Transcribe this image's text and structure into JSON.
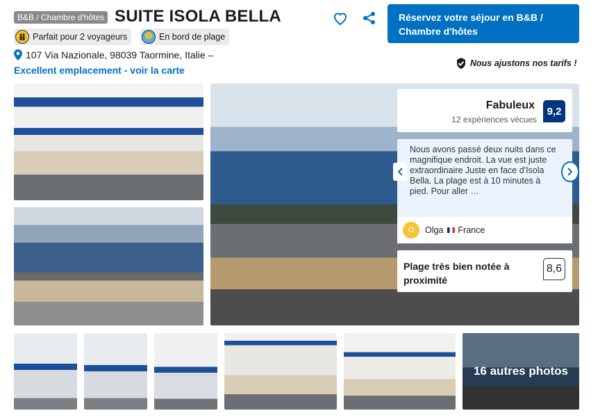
{
  "header": {
    "type_badge": "B&B / Chambre d'hôtes",
    "title": "SUITE ISOLA BELLA",
    "tags": [
      {
        "label": "Parfait pour 2 voyageurs",
        "icon": "people-icon"
      },
      {
        "label": "En bord de plage",
        "icon": "beach-icon"
      }
    ],
    "address": "107 Via Nazionale, 98039 Taormine, Italie –",
    "map_link": "Excellent emplacement - voir la carte",
    "reserve_button": "Réservez votre séjour en B&B / Chambre d'hôtes",
    "price_note": "Nous ajustons nos tarifs !"
  },
  "gallery": {
    "more_photos": "16 autres photos"
  },
  "rating": {
    "label": "Fabuleux",
    "count": "12 expériences vécues",
    "score": "9,2"
  },
  "review": {
    "text": "Nous avons passé deux nuits dans ce magnifique endroit. La vue est juste extraordinaire Juste en face d'Isola Bella. La plage est à 10 minutes à pied. Pour aller …",
    "avatar_letter": "O",
    "reviewer": "Olga",
    "country": "France"
  },
  "location": {
    "label": "Plage très bien notée à proximité",
    "score": "8,6"
  },
  "colors": {
    "accent": "#0071c2",
    "score_badge": "#003580",
    "review_bg": "#ebf3ff"
  }
}
